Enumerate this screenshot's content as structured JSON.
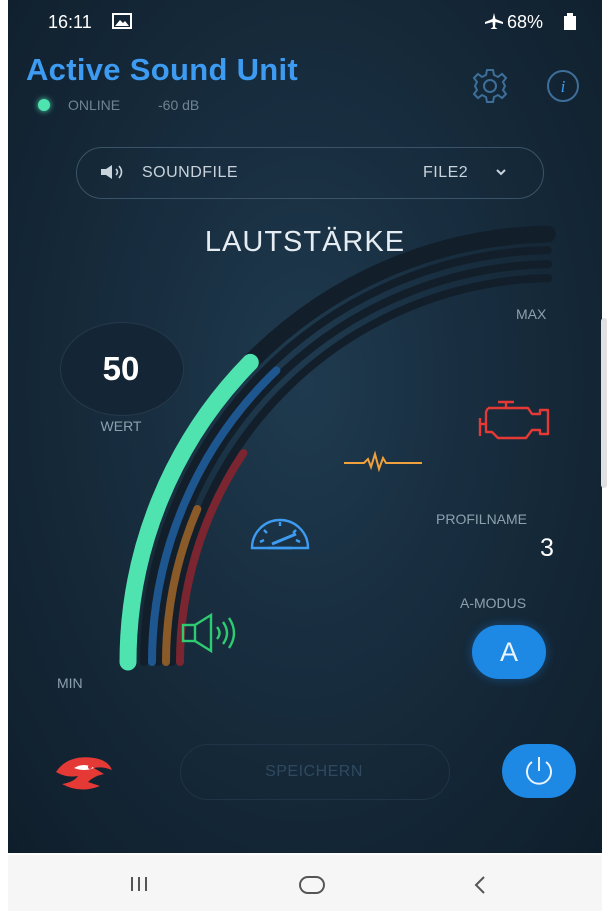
{
  "status_bar": {
    "time": "16:11",
    "battery": "68%"
  },
  "header": {
    "title": "Active Sound Unit",
    "online_label": "ONLINE",
    "signal_db": "-60 dB"
  },
  "soundfile": {
    "label": "SOUNDFILE",
    "selected": "FILE2"
  },
  "gauge": {
    "heading": "LAUTSTÄRKE",
    "value": "50",
    "value_label": "WERT",
    "max_label": "MAX",
    "min_label": "MIN",
    "level_fraction": 0.5
  },
  "profile": {
    "label": "PROFILNAME",
    "value": "3"
  },
  "mode": {
    "label": "A-MODUS",
    "value": "A"
  },
  "actions": {
    "save_label": "SPEICHERN"
  },
  "colors": {
    "accent": "#3d9cf2",
    "online": "#4fe3b0",
    "gauge_fill": "#4fe3b0",
    "arc_red": "#7a2530",
    "arc_orange": "#8a5a28",
    "arc_blue": "#1e5690",
    "engine_icon": "#e53935",
    "wave_icon": "#f0a03c",
    "speedo_icon": "#3d9cf2",
    "speaker_icon": "#2ecc71",
    "button_blue": "#1e88e5"
  },
  "icons": [
    "image-icon",
    "airplane-icon",
    "battery-icon",
    "gear-icon",
    "info-icon",
    "speaker-small-icon",
    "chevron-down-icon",
    "engine-icon",
    "sound-wave-icon",
    "speedometer-icon",
    "speaker-icon",
    "brand-logo-icon",
    "power-icon",
    "recent-apps-icon",
    "home-icon",
    "back-icon"
  ]
}
